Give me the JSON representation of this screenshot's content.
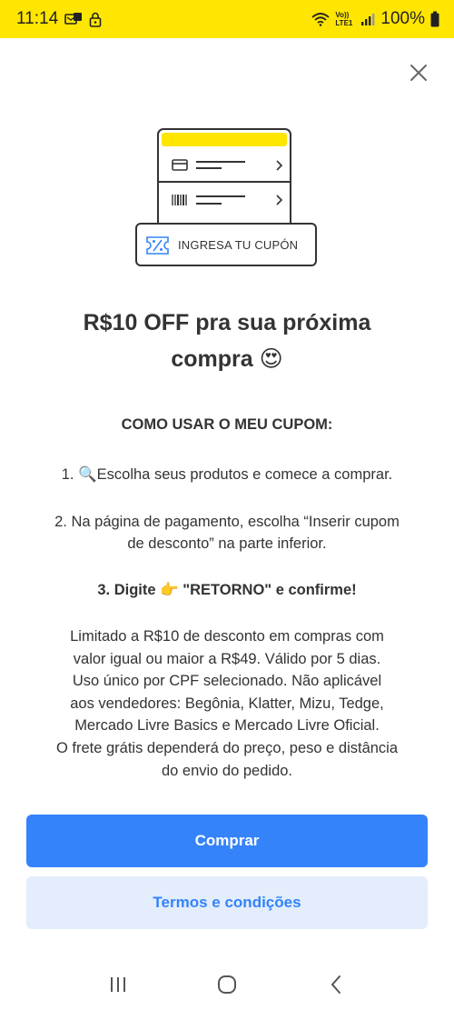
{
  "status_bar": {
    "time": "11:14",
    "network_label": "Vo)) LTE1",
    "battery": "100%"
  },
  "illustration": {
    "coupon_label": "INGRESA TU CUPÓN"
  },
  "headline": {
    "line1": "R$10 OFF pra sua próxima",
    "line2": "compra",
    "emoji": "😍"
  },
  "how_to": {
    "title": "COMO USAR O MEU CUPOM:",
    "step1_prefix": "1.",
    "step1_emoji": "🔍",
    "step1_text": "Escolha seus produtos e comece a comprar.",
    "step2_line1": "2. Na página de pagamento, escolha “Inserir cupom",
    "step2_line2": "de desconto” na parte inferior.",
    "step3_prefix": "3. Digite",
    "step3_emoji": "👉",
    "step3_text": "\"RETORNO\" e confirme!"
  },
  "disclaimer": {
    "lines": [
      "Limitado a R$10 de desconto em compras com",
      "valor igual ou maior a R$49. Válido por 5 dias.",
      "Uso único por CPF selecionado. Não aplicável",
      "aos vendedores: Begônia, Klatter, Mizu, Tedge,",
      "Mercado Livre Basics e Mercado Livre Oficial.",
      "O frete grátis dependerá do preço, peso e distância",
      "do envio do pedido."
    ]
  },
  "buttons": {
    "primary_label": "Comprar",
    "secondary_label": "Termos e condições"
  },
  "colors": {
    "brand_yellow": "#ffe600",
    "primary_blue": "#3483fa",
    "secondary_bg": "#e3edfb"
  },
  "icons": [
    "close-icon",
    "card-icon",
    "barcode-icon",
    "chevron-right-icon",
    "coupon-icon",
    "recent-apps-icon",
    "home-icon",
    "back-icon"
  ]
}
